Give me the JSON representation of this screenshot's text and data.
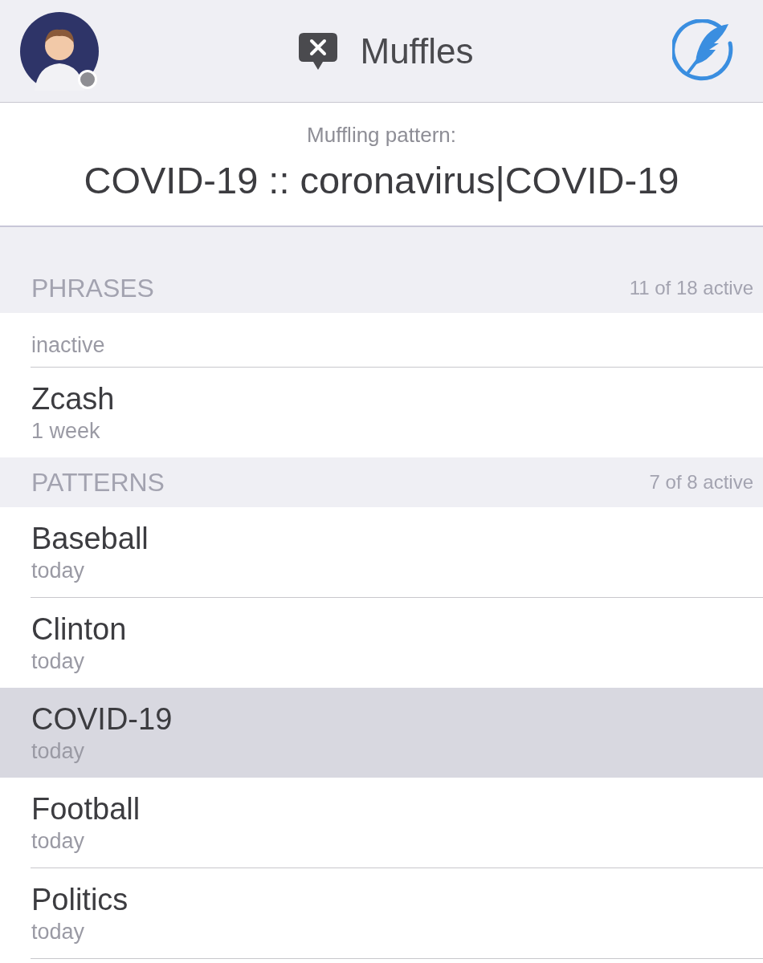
{
  "header": {
    "title": "Muffles"
  },
  "pattern": {
    "label": "Muffling pattern:",
    "value": "COVID-19 :: coronavirus|COVID-19"
  },
  "sections": [
    {
      "title": "PHRASES",
      "count": "11 of 18 active",
      "rows": [
        {
          "subtitle": "inactive",
          "selected": false,
          "partial": true
        },
        {
          "title": "Zcash",
          "subtitle": "1 week",
          "selected": false,
          "partial": false
        }
      ]
    },
    {
      "title": "PATTERNS",
      "count": "7 of 8 active",
      "rows": [
        {
          "title": "Baseball",
          "subtitle": "today",
          "selected": false,
          "partial": false
        },
        {
          "title": "Clinton",
          "subtitle": "today",
          "selected": false,
          "partial": false
        },
        {
          "title": "COVID-19",
          "subtitle": "today",
          "selected": true,
          "partial": false
        },
        {
          "title": "Football",
          "subtitle": "today",
          "selected": false,
          "partial": false
        },
        {
          "title": "Politics",
          "subtitle": "today",
          "selected": false,
          "partial": false
        }
      ]
    }
  ]
}
